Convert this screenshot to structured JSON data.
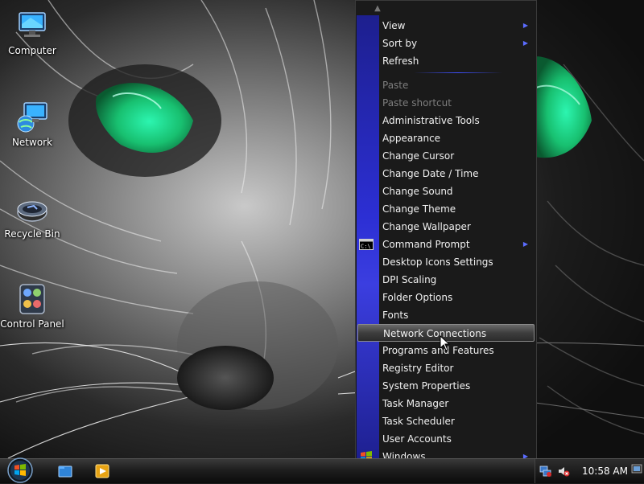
{
  "desktop": {
    "icons": [
      {
        "label": "Computer",
        "icon": "computer-icon"
      },
      {
        "label": "Network",
        "icon": "network-icon"
      },
      {
        "label": "Recycle Bin",
        "icon": "recycle-bin-icon"
      },
      {
        "label": "Control Panel",
        "icon": "control-panel-icon"
      }
    ]
  },
  "context_menu": {
    "group1": [
      {
        "label": "View",
        "submenu": true
      },
      {
        "label": "Sort by",
        "submenu": true
      },
      {
        "label": "Refresh",
        "submenu": false
      }
    ],
    "group2": [
      {
        "label": "Paste",
        "disabled": true
      },
      {
        "label": "Paste shortcut",
        "disabled": true
      },
      {
        "label": "Administrative Tools"
      },
      {
        "label": "Appearance"
      },
      {
        "label": "Change Cursor"
      },
      {
        "label": "Change Date / Time"
      },
      {
        "label": "Change Sound"
      },
      {
        "label": "Change Theme"
      },
      {
        "label": "Change Wallpaper"
      },
      {
        "label": "Command Prompt",
        "submenu": true,
        "icon": "command-prompt-icon",
        "icon_text": "C:\\_"
      },
      {
        "label": "Desktop Icons Settings"
      },
      {
        "label": "DPI Scaling"
      },
      {
        "label": "Folder Options"
      },
      {
        "label": "Fonts"
      },
      {
        "label": "Network Connections",
        "highlighted": true
      },
      {
        "label": "Programs and Features"
      },
      {
        "label": "Registry Editor"
      },
      {
        "label": "System Properties"
      },
      {
        "label": "Task Manager"
      },
      {
        "label": "Task Scheduler"
      },
      {
        "label": "User Accounts"
      },
      {
        "label": "Windows",
        "submenu": true,
        "icon": "windows-logo-icon"
      }
    ],
    "submenu_arrow": "▶",
    "scroll_up": "▲",
    "scroll_down": "▼"
  },
  "taskbar": {
    "start_button": "start-orb-icon",
    "pinned": [
      {
        "name": "explorer-button",
        "icon": "explorer-icon"
      },
      {
        "name": "media-player-button",
        "icon": "media-player-icon"
      }
    ],
    "tray_icons": [
      "network-tray-icon",
      "volume-muted-icon"
    ],
    "clock": "10:58 AM"
  },
  "colors": {
    "menu_strip": "#2c2fd4",
    "menu_bg": "#1a1a1a",
    "accent_green": "#22e6a0"
  }
}
